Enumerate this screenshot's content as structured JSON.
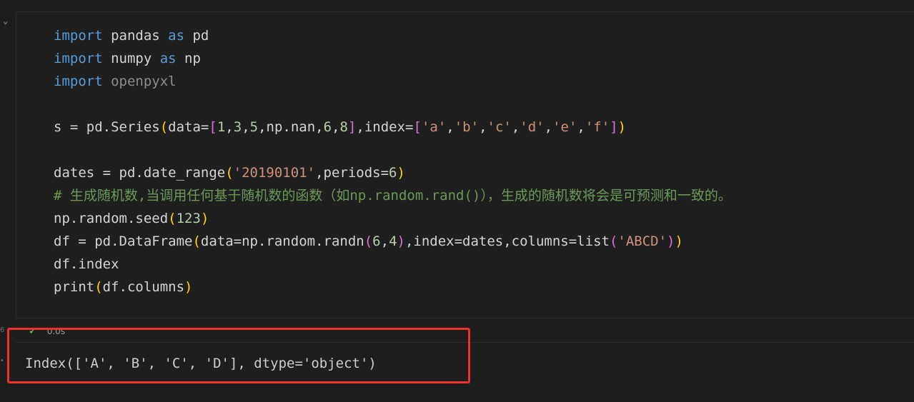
{
  "cell": {
    "collapse_icon": "chevron-down-icon",
    "code_lines": [
      [
        {
          "t": "import",
          "c": "kw"
        },
        {
          "t": " pandas ",
          "c": "mod"
        },
        {
          "t": "as",
          "c": "kw"
        },
        {
          "t": " pd",
          "c": "mod"
        }
      ],
      [
        {
          "t": "import",
          "c": "kw"
        },
        {
          "t": " numpy ",
          "c": "mod"
        },
        {
          "t": "as",
          "c": "kw"
        },
        {
          "t": " np",
          "c": "mod"
        }
      ],
      [
        {
          "t": "import",
          "c": "kw"
        },
        {
          "t": " openpyxl",
          "c": "mod-dim"
        }
      ],
      [],
      [
        {
          "t": "s = pd.",
          "c": "mod"
        },
        {
          "t": "Series",
          "c": "mod"
        },
        {
          "t": "(",
          "c": "br1"
        },
        {
          "t": "data=",
          "c": "mod"
        },
        {
          "t": "[",
          "c": "br2"
        },
        {
          "t": "1",
          "c": "num"
        },
        {
          "t": ",",
          "c": "mod"
        },
        {
          "t": "3",
          "c": "num"
        },
        {
          "t": ",",
          "c": "mod"
        },
        {
          "t": "5",
          "c": "num"
        },
        {
          "t": ",np.nan,",
          "c": "mod"
        },
        {
          "t": "6",
          "c": "num"
        },
        {
          "t": ",",
          "c": "mod"
        },
        {
          "t": "8",
          "c": "num"
        },
        {
          "t": "]",
          "c": "br2"
        },
        {
          "t": ",index=",
          "c": "mod"
        },
        {
          "t": "[",
          "c": "br2"
        },
        {
          "t": "'a'",
          "c": "str"
        },
        {
          "t": ",",
          "c": "mod"
        },
        {
          "t": "'b'",
          "c": "str"
        },
        {
          "t": ",",
          "c": "mod"
        },
        {
          "t": "'c'",
          "c": "str"
        },
        {
          "t": ",",
          "c": "mod"
        },
        {
          "t": "'d'",
          "c": "str"
        },
        {
          "t": ",",
          "c": "mod"
        },
        {
          "t": "'e'",
          "c": "str"
        },
        {
          "t": ",",
          "c": "mod"
        },
        {
          "t": "'f'",
          "c": "str"
        },
        {
          "t": "]",
          "c": "br2"
        },
        {
          "t": ")",
          "c": "br1"
        }
      ],
      [],
      [
        {
          "t": "dates = pd.date_range",
          "c": "mod"
        },
        {
          "t": "(",
          "c": "br1"
        },
        {
          "t": "'20190101'",
          "c": "str"
        },
        {
          "t": ",periods=",
          "c": "mod"
        },
        {
          "t": "6",
          "c": "num"
        },
        {
          "t": ")",
          "c": "br1"
        }
      ],
      [
        {
          "t": "# 生成随机数,当调用任何基于随机数的函数（如np.random.rand()），生成的随机数将会是可预测和一致的。",
          "c": "cmt"
        }
      ],
      [
        {
          "t": "np.random.seed",
          "c": "mod"
        },
        {
          "t": "(",
          "c": "br1"
        },
        {
          "t": "123",
          "c": "num"
        },
        {
          "t": ")",
          "c": "br1"
        }
      ],
      [
        {
          "t": "df = pd.DataFrame",
          "c": "mod"
        },
        {
          "t": "(",
          "c": "br1"
        },
        {
          "t": "data=np.random.randn",
          "c": "mod"
        },
        {
          "t": "(",
          "c": "br2"
        },
        {
          "t": "6",
          "c": "num"
        },
        {
          "t": ",",
          "c": "mod"
        },
        {
          "t": "4",
          "c": "num"
        },
        {
          "t": ")",
          "c": "br2"
        },
        {
          "t": ",index=dates,columns=list",
          "c": "mod"
        },
        {
          "t": "(",
          "c": "br2"
        },
        {
          "t": "'ABCD'",
          "c": "str"
        },
        {
          "t": ")",
          "c": "br2"
        },
        {
          "t": ")",
          "c": "br1"
        }
      ],
      [
        {
          "t": "df.index",
          "c": "mod"
        }
      ],
      [
        {
          "t": "print",
          "c": "mod"
        },
        {
          "t": "(",
          "c": "br1"
        },
        {
          "t": "df.columns",
          "c": "mod"
        },
        {
          "t": ")",
          "c": "br1"
        }
      ]
    ]
  },
  "execution": {
    "count_label": "6",
    "status_icon": "check-icon",
    "duration": "0.0s"
  },
  "output": {
    "text": "Index(['A', 'B', 'C', 'D'], dtype='object')"
  },
  "annotation": {
    "highlight_color": "#f0302a"
  }
}
